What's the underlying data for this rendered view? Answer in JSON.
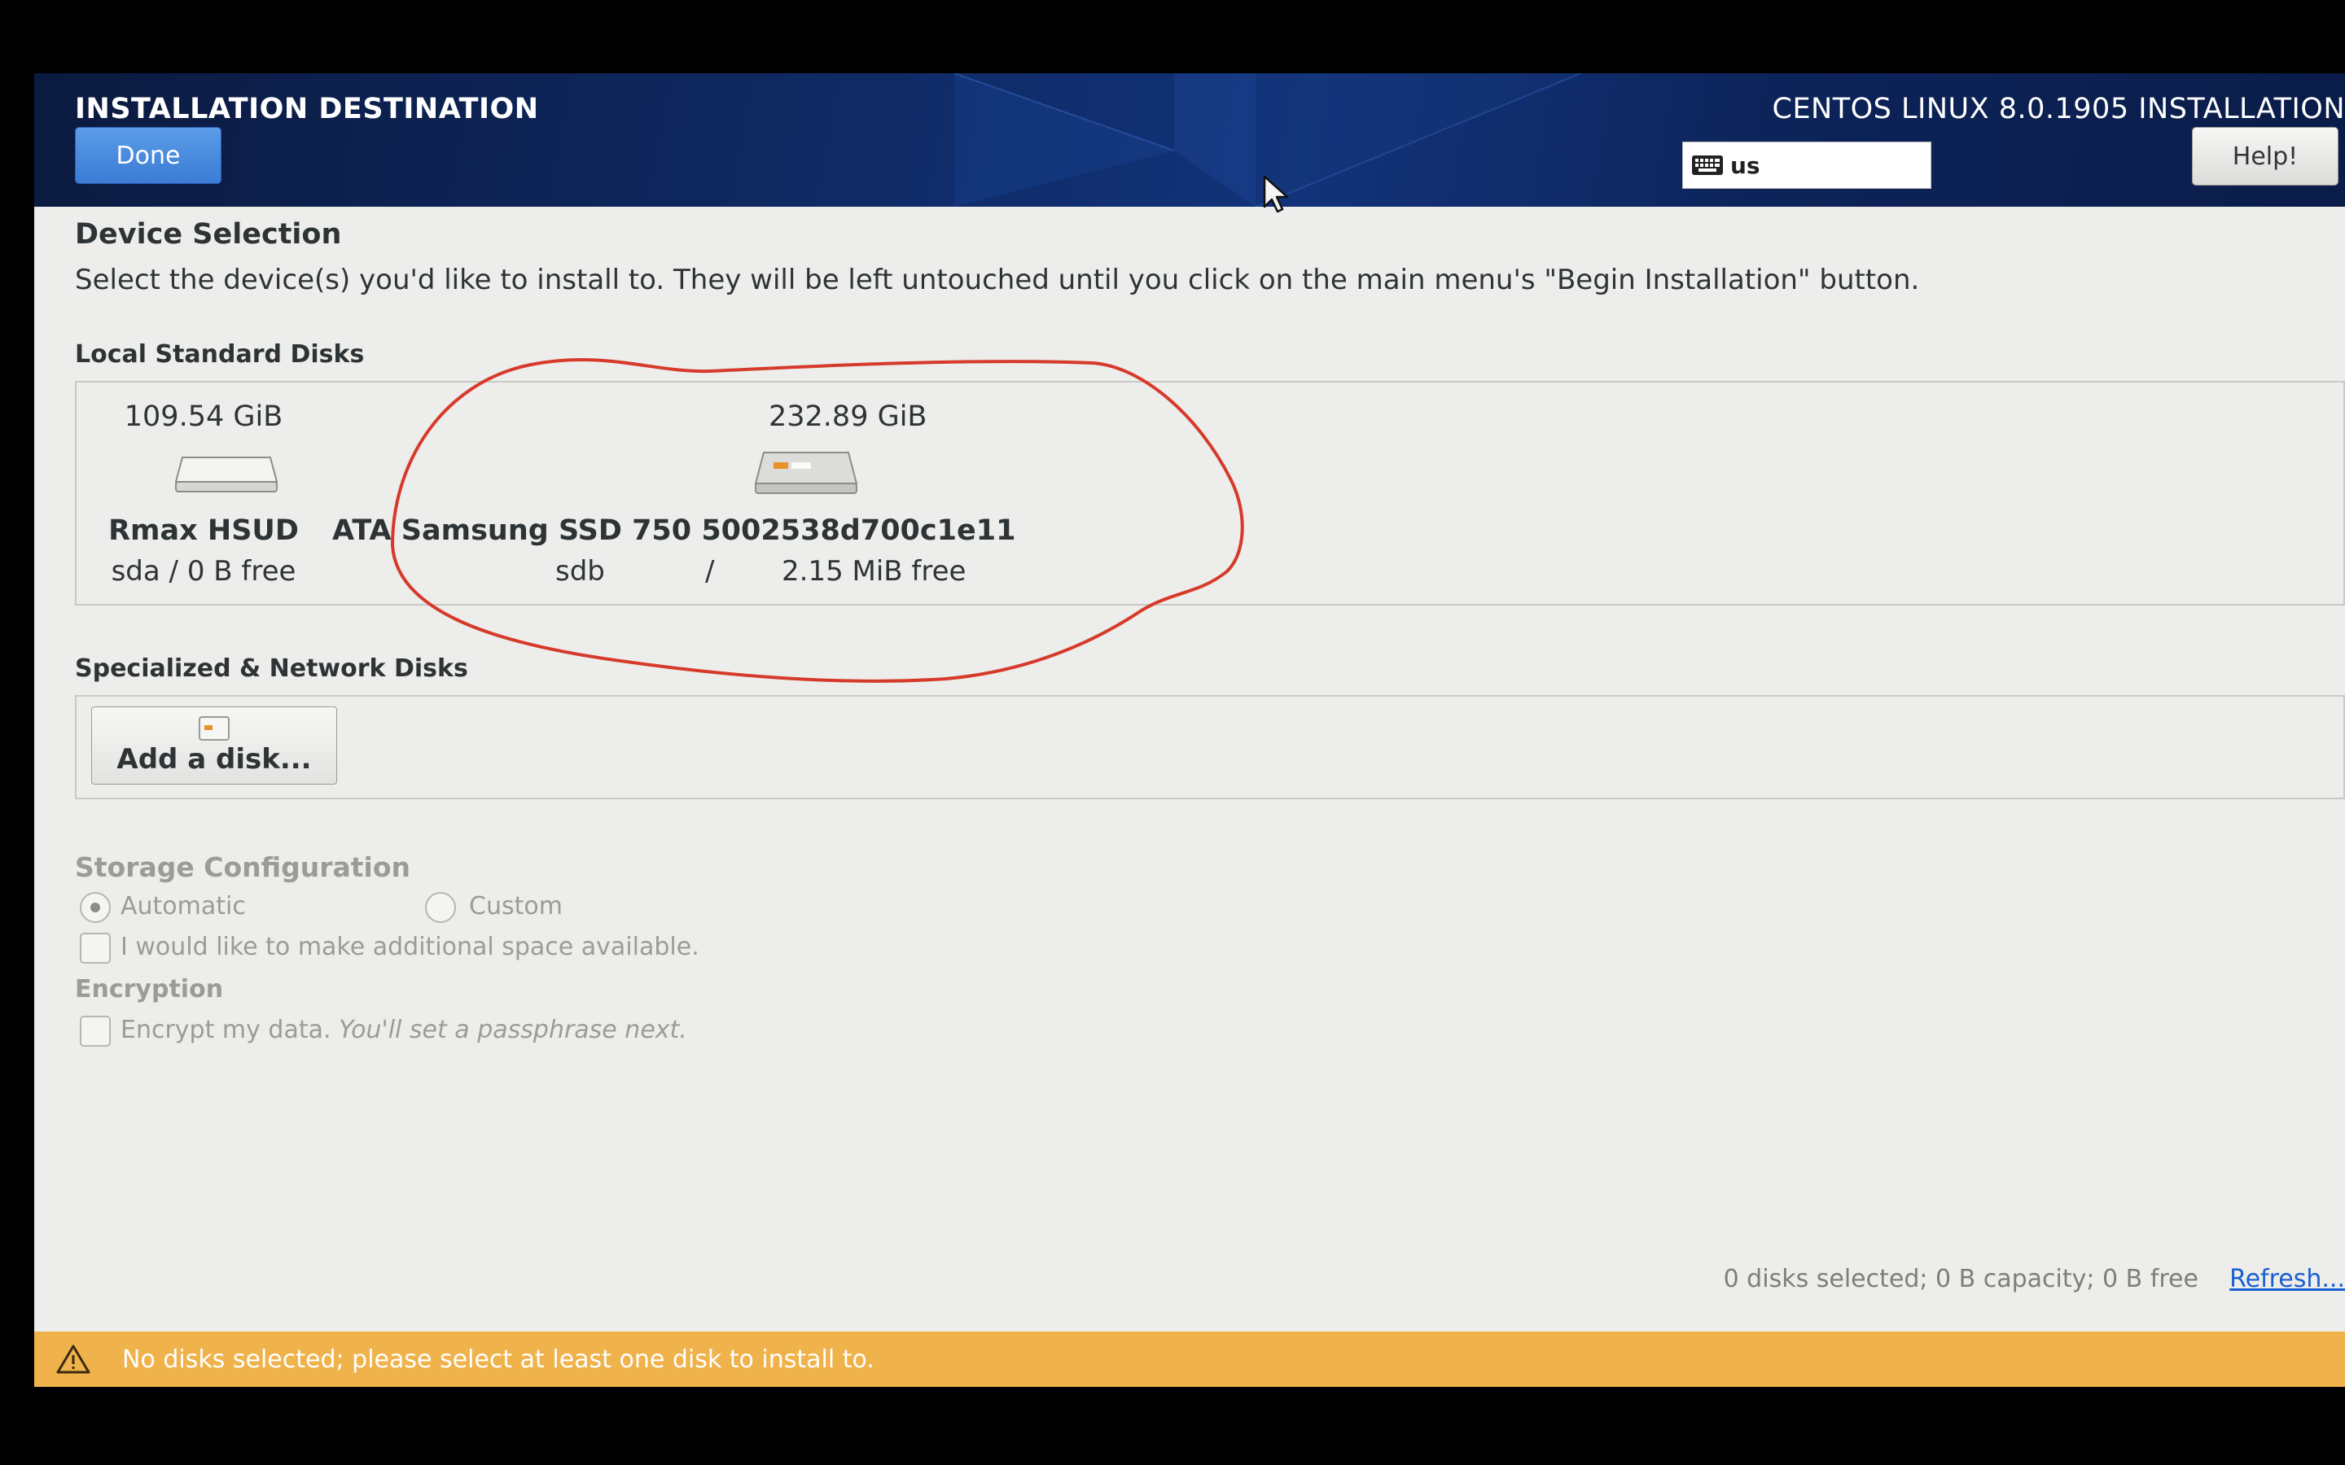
{
  "header": {
    "spoke_title": "INSTALLATION DESTINATION",
    "product_title": "CENTOS LINUX 8.0.1905 INSTALLATION",
    "done_label": "Done",
    "keyboard_layout": "us",
    "help_label": "Help!"
  },
  "device_selection": {
    "heading": "Device Selection",
    "description": "Select the device(s) you'd like to install to.  They will be left untouched until you click on the main menu's \"Begin Installation\" button."
  },
  "local_disks": {
    "heading": "Local Standard Disks",
    "disks": [
      {
        "size": "109.54 GiB",
        "name": "Rmax HSUD",
        "device": "sda",
        "separator": "/",
        "free": "0 B free"
      },
      {
        "size": "232.89 GiB",
        "name": "ATA Samsung SSD 750 5002538d700c1e11",
        "device": "sdb",
        "separator": "/",
        "free": "2.15 MiB free"
      }
    ]
  },
  "network_disks": {
    "heading": "Specialized & Network Disks",
    "add_disk_label": "Add a disk..."
  },
  "storage_config": {
    "heading": "Storage Configuration",
    "automatic_label": "Automatic",
    "custom_label": "Custom",
    "selected": "Automatic",
    "reclaim_label": "I would like to make additional space available."
  },
  "encryption": {
    "heading": "Encryption",
    "encrypt_label": "Encrypt my data.",
    "encrypt_hint": "You'll set a passphrase next."
  },
  "summary": {
    "text": "0 disks selected; 0 B capacity; 0 B free",
    "refresh_label": "Refresh..."
  },
  "warning": {
    "text": "No disks selected; please select at least one disk to install to."
  },
  "colors": {
    "header_bg": "#0f2a64",
    "done_button": "#3a7bd5",
    "warning_bar": "#f0b24a",
    "annotation": "#d63a2a",
    "link": "#1a5fd1"
  }
}
